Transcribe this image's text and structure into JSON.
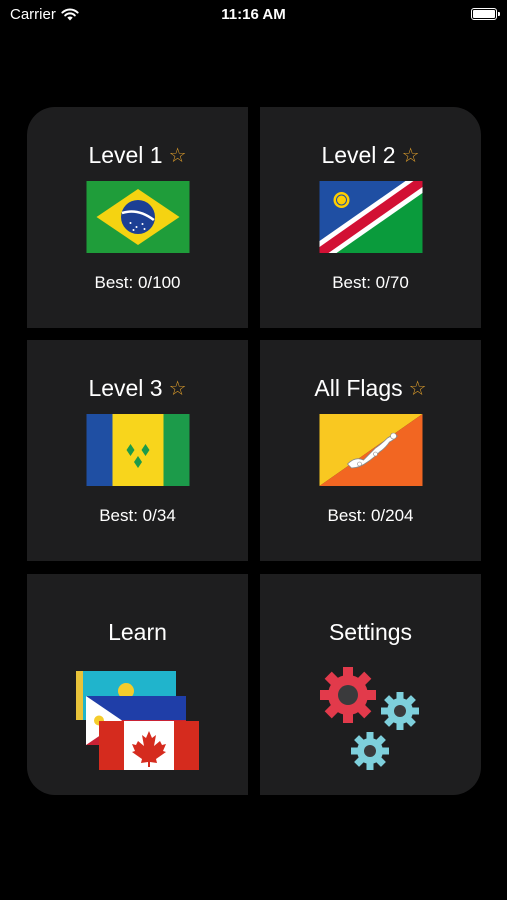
{
  "status": {
    "carrier": "Carrier",
    "time": "11:16 AM"
  },
  "tiles": [
    {
      "title": "Level 1",
      "best": "Best: 0/100",
      "flag": "brazil"
    },
    {
      "title": "Level 2",
      "best": "Best: 0/70",
      "flag": "namibia"
    },
    {
      "title": "Level 3",
      "best": "Best: 0/34",
      "flag": "saint-vincent"
    },
    {
      "title": "All Flags",
      "best": "Best: 0/204",
      "flag": "bhutan"
    }
  ],
  "learn": {
    "title": "Learn"
  },
  "settings": {
    "title": "Settings"
  },
  "colors": {
    "background": "#000000",
    "tile": "#1e1e1f",
    "star": "#d99a2b"
  }
}
